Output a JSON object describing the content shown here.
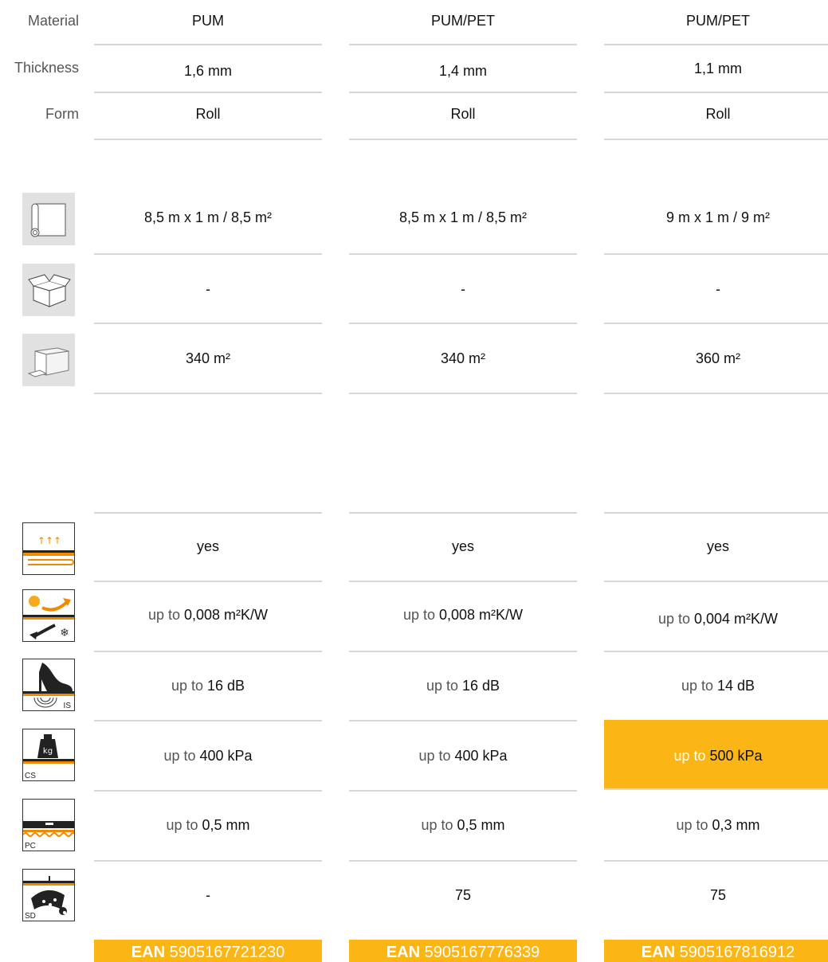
{
  "specs": {
    "rows": [
      {
        "label": "Material",
        "values": [
          "PUM",
          "PUM/PET",
          "PUM/PET"
        ]
      },
      {
        "label": "Thickness",
        "values": [
          "1,6 mm",
          "1,4 mm",
          "1,1 mm"
        ]
      },
      {
        "label": "Form",
        "values": [
          "Roll",
          "Roll",
          "Roll"
        ]
      }
    ]
  },
  "packaging": {
    "rows": [
      {
        "icon": "roll-dimensions-icon",
        "values": [
          "8,5 m x 1 m / 8,5 m²",
          "8,5 m x 1 m / 8,5 m²",
          "9 m x 1 m / 9 m²"
        ]
      },
      {
        "icon": "box-icon",
        "values": [
          "-",
          "-",
          "-"
        ]
      },
      {
        "icon": "pallet-icon",
        "values": [
          "340 m²",
          "340 m²",
          "360 m²"
        ]
      }
    ]
  },
  "performance": {
    "prefix": "up to",
    "rows": [
      {
        "icon": "underfloor-heating-icon",
        "values": [
          "yes",
          "yes",
          "yes"
        ]
      },
      {
        "icon": "thermal-resistance-icon",
        "values": [
          "0,008 m²K/W",
          "0,008 m²K/W",
          "0,004 m²K/W"
        ],
        "prefixed": true
      },
      {
        "icon": "impact-sound-icon",
        "tag": "IS",
        "values": [
          "16 dB",
          "16 dB",
          "14 dB"
        ],
        "prefixed": true
      },
      {
        "icon": "compressive-strength-icon",
        "tag": "CS",
        "values": [
          "400  kPa",
          "400  kPa",
          "500 kPa"
        ],
        "prefixed": true
      },
      {
        "icon": "point-compensation-icon",
        "tag": "PC",
        "values": [
          "0,5 mm",
          "0,5 mm",
          "0,3 mm"
        ],
        "prefixed": true
      },
      {
        "icon": "vapour-barrier-icon",
        "tag": "SD",
        "values": [
          "-",
          "75",
          "75"
        ]
      }
    ],
    "highlight_color": "#fbb615"
  },
  "ean": {
    "label": "EAN",
    "codes": [
      "5905167721230",
      "5905167776339",
      "5905167816912"
    ]
  }
}
